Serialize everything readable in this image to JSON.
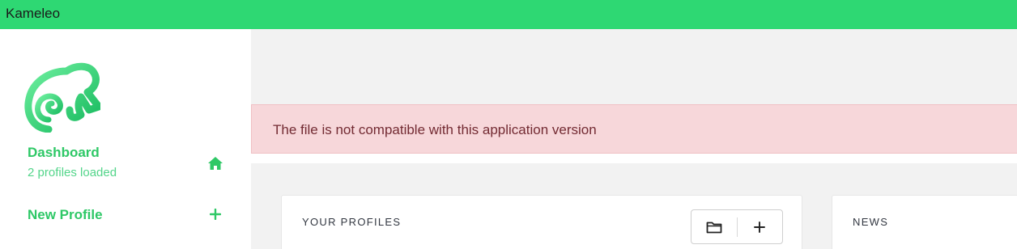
{
  "window": {
    "title": "Kameleo"
  },
  "sidebar": {
    "logo": "kameleo-chameleon-logo",
    "items": [
      {
        "label": "Dashboard",
        "sub": "2 profiles loaded",
        "icon": "home-icon"
      },
      {
        "label": "New Profile",
        "icon": "plus-icon"
      }
    ]
  },
  "alert": {
    "message": "The file is not compatible with this application version"
  },
  "main": {
    "profiles_card": {
      "title": "YOUR PROFILES",
      "buttons": [
        "folder-icon",
        "plus-icon"
      ]
    },
    "news_card": {
      "title": "NEWS"
    }
  },
  "colors": {
    "accent": "#2ed873",
    "nav_text": "#2ec866",
    "alert_bg": "#f7d7da",
    "alert_text": "#732b33"
  }
}
